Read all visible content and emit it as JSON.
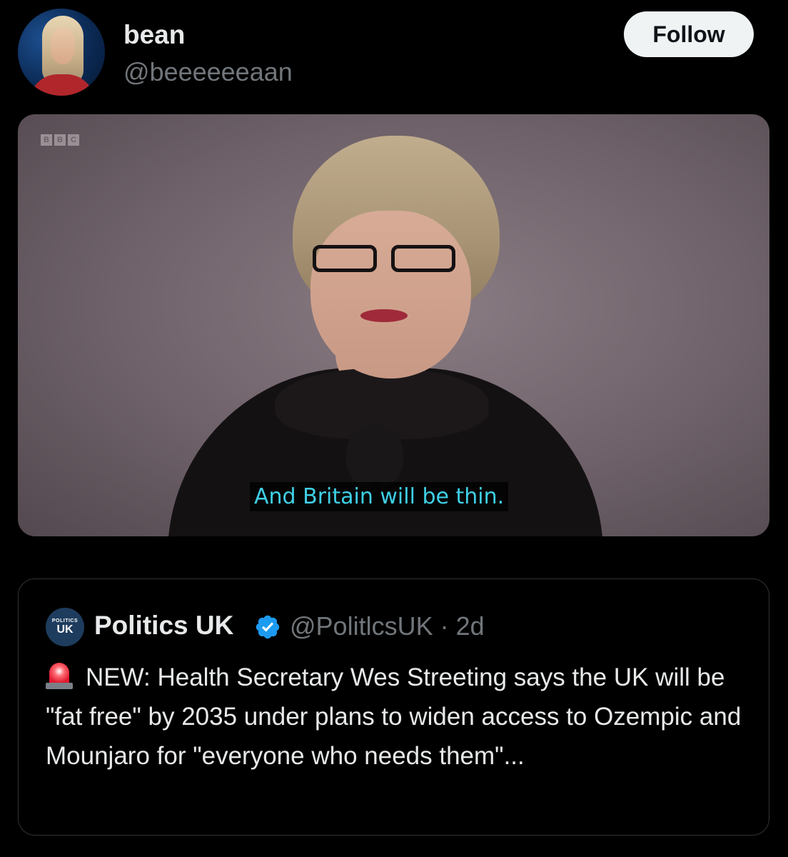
{
  "post": {
    "author": {
      "name": "bean",
      "handle": "@beeeeeeaan"
    },
    "follow_label": "Follow",
    "media": {
      "channel_logo": [
        "B",
        "B",
        "C"
      ],
      "subtitle": "And Britain will be thin."
    }
  },
  "quoted_post": {
    "avatar_small": "POLITICS",
    "avatar_big": "UK",
    "name": "Politics UK",
    "handle_time": "@PolitlcsUK · 2d",
    "text": "NEW: Health Secretary Wes Streeting says the UK will be \"fat free\" by 2035 under plans to widen access to Ozempic and Mounjaro for \"everyone who needs them\"...",
    "emoji_icon": "police-siren-icon",
    "verified_color": "#1d9bf0"
  },
  "colors": {
    "background": "#000000",
    "subtitle": "#3fd0e6",
    "muted": "#71767b"
  }
}
